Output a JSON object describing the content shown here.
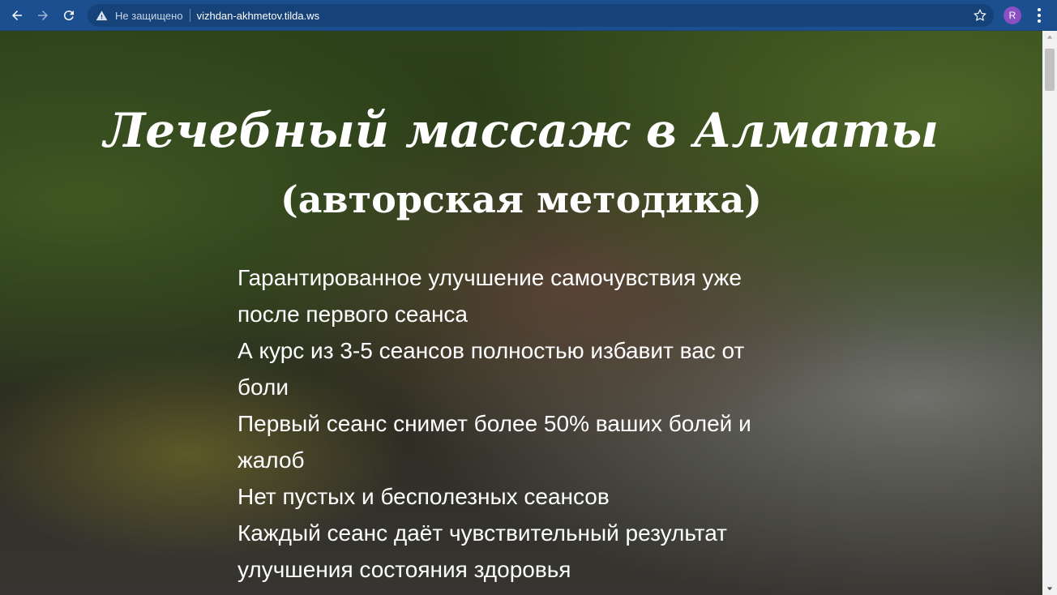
{
  "browser": {
    "security_label": "Не защищено",
    "url": "vizhdan-akhmetov.tilda.ws",
    "profile_initial": "R",
    "icons": {
      "back": "back-arrow-icon",
      "forward": "forward-arrow-icon",
      "reload": "reload-icon",
      "warning": "warning-icon",
      "bookmark": "star-icon",
      "menu": "kebab-menu-icon"
    },
    "colors": {
      "toolbar": "#1c4f8f",
      "omnibox": "#154278",
      "avatar": "#8a4fc1"
    }
  },
  "hero": {
    "title": "Лечебный массаж в Алматы",
    "subtitle": "(авторская методика)",
    "benefits": [
      "Гарантированное улучшение самочувствия уже",
      "после первого сеанса",
      "А курс из 3-5 сеансов полностью избавит вас от",
      "боли",
      "Первый сеанс снимет более 50% ваших болей и",
      "жалоб",
      "Нет пустых и бесполезных сеансов",
      "Каждый сеанс даёт чувствительный результат",
      "улучшения состояния здоровья"
    ]
  }
}
